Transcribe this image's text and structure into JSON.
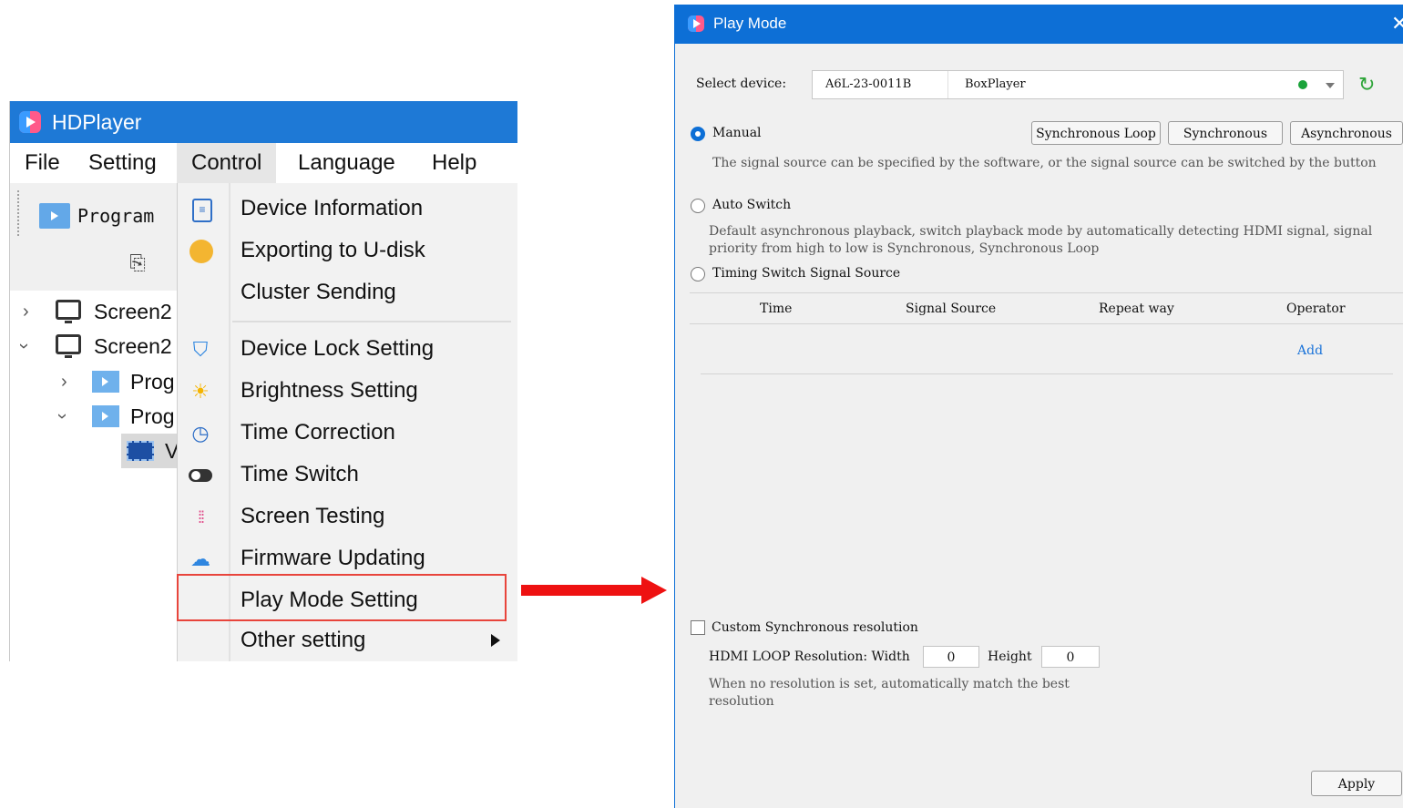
{
  "hdplayer": {
    "title": "HDPlayer",
    "menubar": [
      "File",
      "Setting",
      "Control",
      "Language",
      "Help"
    ],
    "toolbar": {
      "program_label": "Program"
    },
    "tree": [
      {
        "label": "Screen2"
      },
      {
        "label": "Screen2"
      },
      {
        "label": "Prog"
      },
      {
        "label": "Prog"
      },
      {
        "label": "V"
      }
    ],
    "control_menu": [
      {
        "label": "Device Information",
        "icon": "device-info-icon"
      },
      {
        "label": "Exporting to U-disk",
        "icon": "udisk-icon"
      },
      {
        "label": "Cluster Sending",
        "icon": ""
      },
      {
        "label": "Device Lock Setting",
        "icon": "shield-icon"
      },
      {
        "label": "Brightness Setting",
        "icon": "sun-icon"
      },
      {
        "label": "Time Correction",
        "icon": "clock-icon"
      },
      {
        "label": "Time Switch",
        "icon": "toggle-icon"
      },
      {
        "label": "Screen Testing",
        "icon": "dots-icon"
      },
      {
        "label": "Firmware Updating",
        "icon": "cloud-upload-icon"
      },
      {
        "label": "Play Mode Setting",
        "icon": ""
      },
      {
        "label": "Other setting",
        "icon": ""
      }
    ],
    "highlighted_item": "Play Mode Setting"
  },
  "play_mode": {
    "title": "Play Mode",
    "close": "✕",
    "select_device_label": "Select device:",
    "device_id": "A6L-23-0011B",
    "device_name": "BoxPlayer",
    "status_color": "#1aa33a",
    "manual_label": "Manual",
    "manual_desc": "The signal source can be specified by the software, or the signal source can be switched by the button",
    "buttons": {
      "sync_loop": "Synchronous Loop",
      "sync": "Synchronous",
      "async": "Asynchronous"
    },
    "auto_switch_label": "Auto Switch",
    "auto_switch_desc": "Default asynchronous playback, switch playback mode by automatically detecting HDMI signal, signal priority from high to low is Synchronous, Synchronous Loop",
    "timing_label": "Timing Switch Signal Source",
    "table_headers": [
      "Time",
      "Signal Source",
      "Repeat way",
      "Operator"
    ],
    "add_label": "Add",
    "custom_res_label": "Custom Synchronous resolution",
    "hdmi_loop_label": "HDMI LOOP Resolution: Width",
    "width_value": "0",
    "height_label": "Height",
    "height_value": "0",
    "res_note": "When no resolution is set, automatically match the best resolution",
    "apply_label": "Apply",
    "selected_mode": "Manual"
  },
  "colors": {
    "hd_titlebar": "#1e79d6",
    "pm_titlebar": "#0d6fd6",
    "highlight_border": "#e8453c",
    "arrow": "#ee1111",
    "link": "#1a73d9"
  }
}
